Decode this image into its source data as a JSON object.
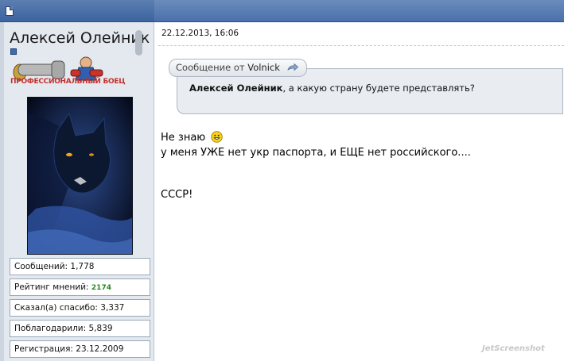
{
  "user": {
    "name": "Алексей Олейник",
    "rank_label": "ПРОФЕССИОНАЛЬНЫЙ БОЕЦ",
    "stats": [
      {
        "label": "Сообщений:",
        "value": "1,778"
      },
      {
        "label": "Рейтинг мнений:",
        "value": "2174"
      },
      {
        "label": "Сказал(а) спасибо:",
        "value": "3,337"
      },
      {
        "label": "Поблагодарили:",
        "value": "5,839"
      },
      {
        "label": "Регистрация:",
        "value": "23.12.2009"
      }
    ]
  },
  "post": {
    "date": "22.12.2013, 16:06",
    "quote": {
      "header_prefix": "Сообщение от",
      "author": "Volnick",
      "quoted_name": "Алексей Олейник",
      "text": ", а какую страну будете представлять?"
    },
    "lines": [
      "Не знаю",
      "у меня УЖЕ нет укр паспорта, и ЕЩЕ нет российского....",
      "СССР!"
    ]
  },
  "watermark": "JetScreenshot",
  "icons": {
    "post": "post-document-icon",
    "status": "user-status-icon",
    "quote_link": "view-post-arrow-icon",
    "smiley": "smiley-icon"
  },
  "colors": {
    "header": "#4b70ab",
    "sidebar": "#e4e9ef",
    "rank_text": "#c2312b",
    "rating": "#2a8a22"
  }
}
